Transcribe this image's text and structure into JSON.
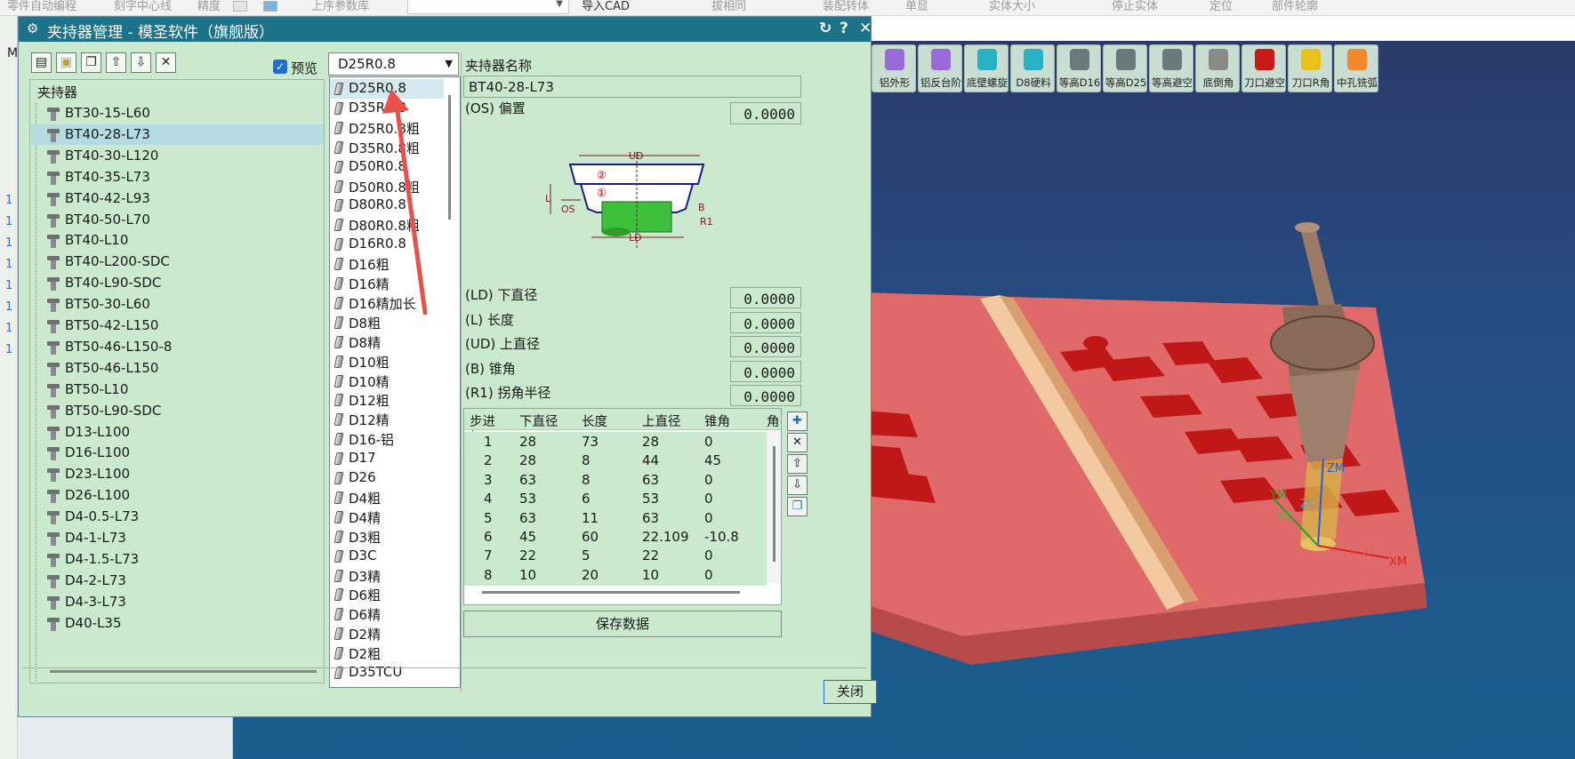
{
  "topbar": {
    "items": [
      "零件自动编程",
      "刻字中心线",
      "精度",
      "上序参数库",
      "导入CAD",
      "拔相同",
      "装配转体",
      "单显",
      "实体大小",
      "停止实体",
      "定位",
      "部件轮廓"
    ]
  },
  "left_strip": {
    "label": "M",
    "marks": [
      "1",
      "1",
      "1",
      "1",
      "1",
      "1",
      "1",
      "1"
    ]
  },
  "ribbon": [
    {
      "label": "铝外形",
      "icon": "cube-icon",
      "color": "#9a6ad8"
    },
    {
      "label": "铝反台阶",
      "icon": "cube-icon",
      "color": "#9a6ad8"
    },
    {
      "label": "底壁螺旋",
      "icon": "spiral-icon",
      "color": "#27b2c8"
    },
    {
      "label": "D8硬料",
      "icon": "spiral-icon",
      "color": "#27b2c8"
    },
    {
      "label": "等高D16",
      "icon": "steps-icon",
      "color": "#6a7a7a"
    },
    {
      "label": "等高D25",
      "icon": "steps-icon",
      "color": "#6a7a7a"
    },
    {
      "label": "等高避空",
      "icon": "steps-icon",
      "color": "#6a7a7a"
    },
    {
      "label": "底倒角",
      "icon": "chamfer-icon",
      "color": "#8a8a8a"
    },
    {
      "label": "刀口避空",
      "icon": "edge-icon",
      "color": "#c81a1a"
    },
    {
      "label": "刀口R角",
      "icon": "edge-icon",
      "color": "#e8c21a"
    },
    {
      "label": "中孔铣弧",
      "icon": "hole-icon",
      "color": "#f08a2a"
    }
  ],
  "axes_labels": {
    "zm": "ZM",
    "zc": "ZC",
    "ym": "YM",
    "yc": "YC",
    "xc": "XC",
    "xm": "XM"
  },
  "dialog": {
    "title": "夹持器管理 - 模圣软件（旗舰版）",
    "controls": {
      "refresh": "↻",
      "help": "?",
      "close": "✕"
    },
    "toolbar": [
      "new-icon",
      "open-folder-icon",
      "copy-icon",
      "move-up-icon",
      "move-down-icon",
      "delete-icon"
    ],
    "preview": {
      "label": "预览",
      "checked": true
    },
    "combo_value": "D25R0.8",
    "tree_header": "夹持器",
    "holders": [
      "BT30-15-L60",
      "BT40-28-L73",
      "BT40-30-L120",
      "BT40-35-L73",
      "BT40-42-L93",
      "BT40-50-L70",
      "BT40-L10",
      "BT40-L200-SDC",
      "BT40-L90-SDC",
      "BT50-30-L60",
      "BT50-42-L150",
      "BT50-46-L150-8",
      "BT50-46-L150",
      "BT50-L10",
      "BT50-L90-SDC",
      "D13-L100",
      "D16-L100",
      "D23-L100",
      "D26-L100",
      "D4-0.5-L73",
      "D4-1-L73",
      "D4-1.5-L73",
      "D4-2-L73",
      "D4-3-L73",
      "D40-L35"
    ],
    "selected_holder_index": 1,
    "tools": [
      "D25R0.8",
      "D35R0.8",
      "D25R0.8粗",
      "D35R0.8粗",
      "D50R0.8",
      "D50R0.8粗",
      "D80R0.8",
      "D80R0.8粗",
      "D16R0.8",
      "D16粗",
      "D16精",
      "D16精加长",
      "D8粗",
      "D8精",
      "D10粗",
      "D10精",
      "D12粗",
      "D12精",
      "D16-铝",
      "D17",
      "D26",
      "D4粗",
      "D4精",
      "D3粗",
      "D3C",
      "D3精",
      "D6粗",
      "D6精",
      "D2精",
      "D2粗",
      "D35TCU"
    ],
    "highlight_tool_index": 0,
    "name_label": "夹持器名称",
    "name_value": "BT40-28-L73",
    "offset_label": "(OS) 偏置",
    "offset_value": "0.0000",
    "diagram": {
      "ud": "UD",
      "l": "L",
      "os": "OS",
      "b": "B",
      "r1": "R1",
      "ld": "LD",
      "c1": "①",
      "c2": "②"
    },
    "params": [
      {
        "label": "(LD) 下直径",
        "value": "0.0000"
      },
      {
        "label": "(L) 长度",
        "value": "0.0000"
      },
      {
        "label": "(UD) 上直径",
        "value": "0.0000"
      },
      {
        "label": "(B) 锥角",
        "value": "0.0000"
      },
      {
        "label": "(R1) 拐角半径",
        "value": "0.0000"
      }
    ],
    "table": {
      "headers": [
        "步进",
        "下直径",
        "长度",
        "上直径",
        "锥角",
        "角"
      ],
      "rows": [
        [
          "1",
          "28",
          "73",
          "28",
          "0"
        ],
        [
          "2",
          "28",
          "8",
          "44",
          "45"
        ],
        [
          "3",
          "63",
          "8",
          "63",
          "0"
        ],
        [
          "4",
          "53",
          "6",
          "53",
          "0"
        ],
        [
          "5",
          "63",
          "11",
          "63",
          "0"
        ],
        [
          "6",
          "45",
          "60",
          "22.109",
          "-10.8"
        ],
        [
          "7",
          "22",
          "5",
          "22",
          "0"
        ],
        [
          "8",
          "10",
          "20",
          "10",
          "0"
        ]
      ]
    },
    "side_buttons": [
      "add-row-icon",
      "delete-row-icon",
      "row-up-icon",
      "row-down-icon",
      "copy-row-icon"
    ],
    "save_label": "保存数据",
    "close_label": "关闭"
  }
}
